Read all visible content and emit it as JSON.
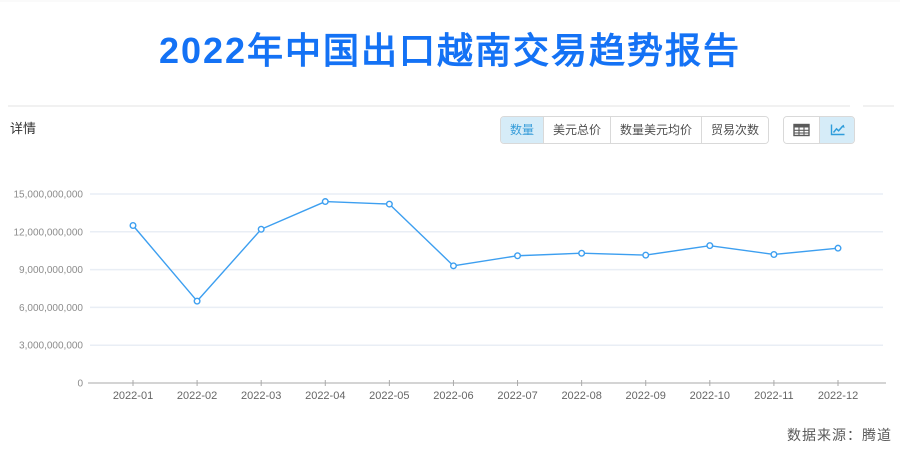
{
  "page": {
    "title": "2022年中国出口越南交易趋势报告",
    "section_label": "详情",
    "source_label": "数据来源：腾道"
  },
  "toolbar": {
    "metric_tabs": [
      {
        "label": "数量",
        "selected": true
      },
      {
        "label": "美元总价",
        "selected": false
      },
      {
        "label": "数量美元均价",
        "selected": false
      },
      {
        "label": "贸易次数",
        "selected": false
      }
    ],
    "view_buttons": [
      {
        "icon": "table-icon",
        "selected": false
      },
      {
        "icon": "line-chart-icon",
        "selected": true
      }
    ]
  },
  "colors": {
    "title_blue": "#1472f5",
    "line_blue": "#3d9ff0",
    "selected_tab_bg": "#d6ecf8",
    "selected_tab_text": "#369cd9",
    "grid_line": "#e9eef5",
    "axis_line": "#aaaaaa",
    "x_label": "#666666",
    "y_label": "#8c8c8c"
  },
  "chart_data": {
    "type": "line",
    "title": "2022年中国出口越南交易趋势报告",
    "series_name": "数量",
    "categories": [
      "2022-01",
      "2022-02",
      "2022-03",
      "2022-04",
      "2022-05",
      "2022-06",
      "2022-07",
      "2022-08",
      "2022-09",
      "2022-10",
      "2022-11",
      "2022-12"
    ],
    "values": [
      12500000000,
      6500000000,
      12200000000,
      14400000000,
      14200000000,
      9300000000,
      10100000000,
      10300000000,
      10150000000,
      10900000000,
      10200000000,
      10700000000
    ],
    "y_ticks": [
      0,
      3000000000,
      6000000000,
      9000000000,
      12000000000,
      15000000000
    ],
    "ylim": [
      0,
      15000000000
    ],
    "xlabel": "",
    "ylabel": "",
    "grid": true,
    "legend_position": "none",
    "marker": "hollow-circle"
  }
}
